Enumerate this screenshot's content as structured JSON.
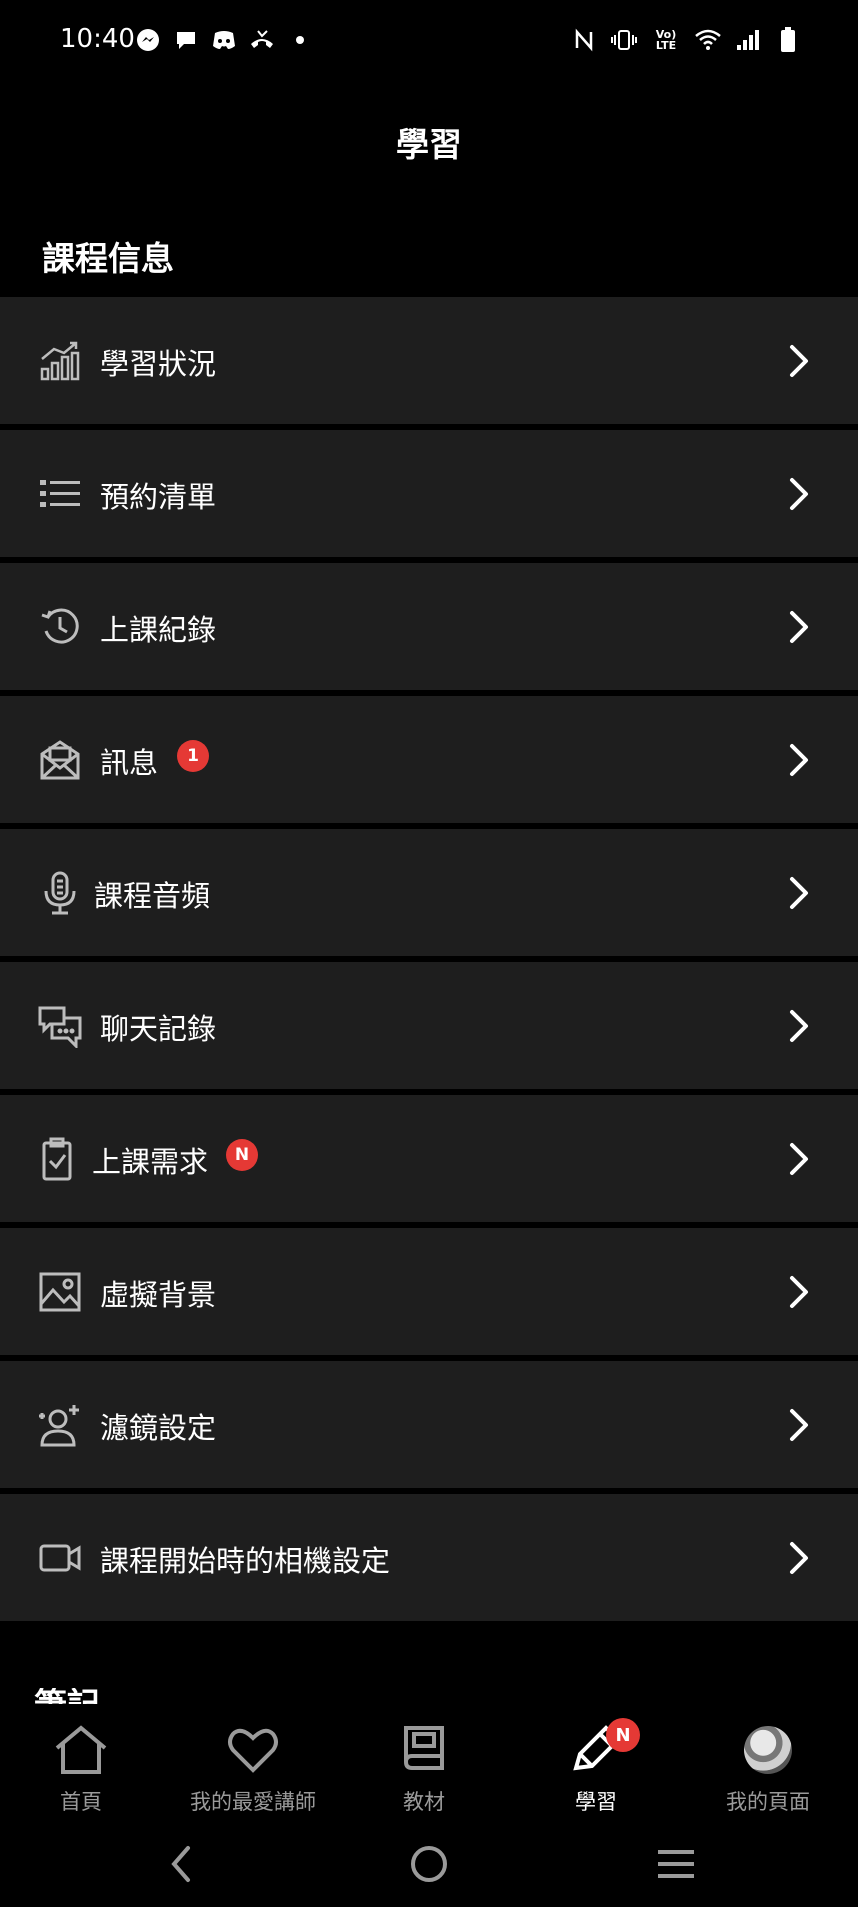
{
  "status_bar": {
    "time": "10:40",
    "left_icons": [
      "messenger-icon",
      "chat-bubble-icon",
      "discord-icon",
      "missed-call-icon",
      "dot-icon"
    ],
    "right_icons": [
      "nfc-icon",
      "vibrate-icon",
      "volte-icon",
      "wifi-icon",
      "signal-icon",
      "battery-icon"
    ],
    "volte_label": "Vo) LTE"
  },
  "header": {
    "title": "學習"
  },
  "section": {
    "title": "課程信息",
    "next_title": "筆記"
  },
  "menu": {
    "items": [
      {
        "label": "學習狀況",
        "icon": "chart-bars-icon"
      },
      {
        "label": "預約清單",
        "icon": "list-icon"
      },
      {
        "label": "上課紀錄",
        "icon": "history-clock-icon"
      },
      {
        "label": "訊息",
        "icon": "envelope-icon",
        "badge": "1"
      },
      {
        "label": "課程音頻",
        "icon": "microphone-icon"
      },
      {
        "label": "聊天記錄",
        "icon": "chat-history-icon"
      },
      {
        "label": "上課需求",
        "icon": "clipboard-check-icon",
        "badge": "N"
      },
      {
        "label": "虛擬背景",
        "icon": "image-icon"
      },
      {
        "label": "濾鏡設定",
        "icon": "user-sparkle-icon"
      },
      {
        "label": "課程開始時的相機設定",
        "icon": "video-camera-icon"
      }
    ]
  },
  "bottom_nav": {
    "items": [
      {
        "label": "首頁",
        "icon": "home-icon",
        "active": false
      },
      {
        "label": "我的最愛講師",
        "icon": "heart-icon",
        "active": false
      },
      {
        "label": "教材",
        "icon": "book-icon",
        "active": false
      },
      {
        "label": "學習",
        "icon": "pencil-icon",
        "active": true,
        "badge": "N"
      },
      {
        "label": "我的頁面",
        "icon": "avatar",
        "active": false
      }
    ]
  },
  "colors": {
    "background": "#000000",
    "row_background": "#1e1e1e",
    "badge": "#e53935",
    "inactive_text": "#9a9a9a"
  }
}
